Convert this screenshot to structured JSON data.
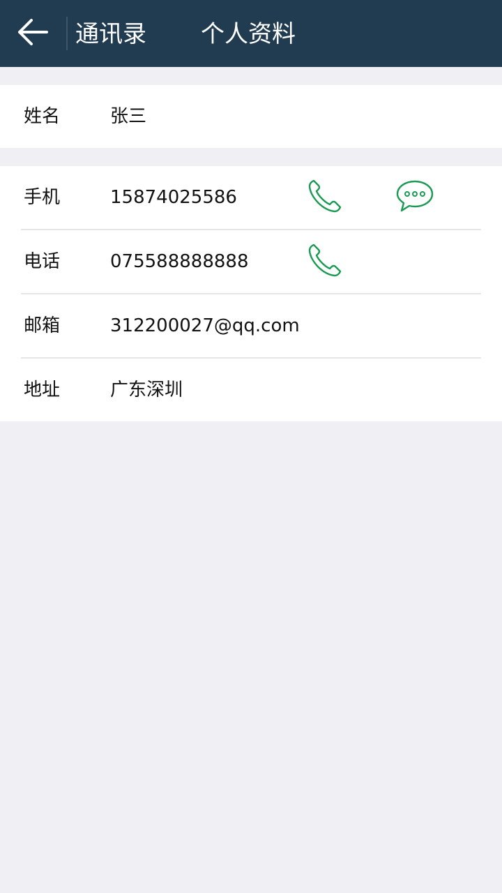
{
  "header": {
    "back_icon": "arrow-left-icon",
    "nav_label": "通讯录",
    "title": "个人资料"
  },
  "profile": {
    "name_label": "姓名",
    "name_value": "张三"
  },
  "contact": {
    "mobile_label": "手机",
    "mobile_value": "15874025586",
    "phone_label": "电话",
    "phone_value": "075588888888",
    "email_label": "邮箱",
    "email_value": "312200027@qq.com",
    "address_label": "地址",
    "address_value": "广东深圳"
  },
  "icons": {
    "call": "phone-icon",
    "message": "chat-bubble-icon"
  },
  "colors": {
    "header_bg": "#213b50",
    "page_bg": "#efeff4",
    "accent_green": "#1a9a52",
    "text": "#111111"
  }
}
